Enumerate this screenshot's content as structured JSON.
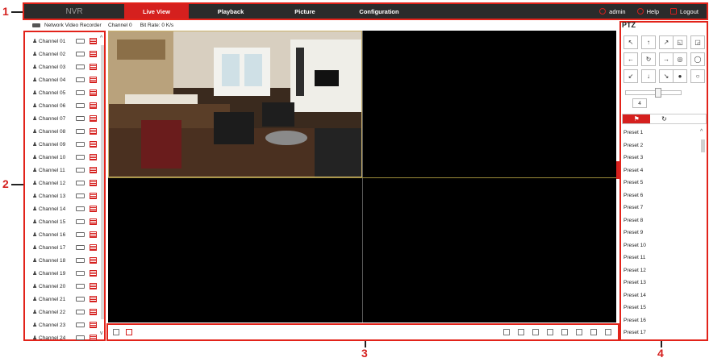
{
  "callouts": {
    "c1": "1",
    "c2": "2",
    "c3": "3",
    "c4": "4"
  },
  "header": {
    "logo": "NVR",
    "nav": [
      "Live View",
      "Playback",
      "Picture",
      "Configuration"
    ],
    "user": "admin",
    "help": "Help",
    "logout": "Logout"
  },
  "sidebar": {
    "device": "Network Video Recorder",
    "channels": [
      "Channel 01",
      "Channel 02",
      "Channel 03",
      "Channel 04",
      "Channel 05",
      "Channel 06",
      "Channel 07",
      "Channel 08",
      "Channel 09",
      "Channel 10",
      "Channel 11",
      "Channel 12",
      "Channel 13",
      "Channel 14",
      "Channel 15",
      "Channel 16",
      "Channel 17",
      "Channel 18",
      "Channel 19",
      "Channel 20",
      "Channel 21",
      "Channel 22",
      "Channel 23",
      "Channel 24"
    ]
  },
  "video": {
    "channel": "Channel 0",
    "bitrate": "Bit Rate: 0 K/s"
  },
  "ptz": {
    "title": "PTZ",
    "speed": "4",
    "presets": [
      "Preset 1",
      "Preset 2",
      "Preset 3",
      "Preset 4",
      "Preset 5",
      "Preset 6",
      "Preset 7",
      "Preset 8",
      "Preset 9",
      "Preset 10",
      "Preset 11",
      "Preset 12",
      "Preset 13",
      "Preset 14",
      "Preset 15",
      "Preset 16",
      "Preset 17"
    ]
  },
  "colors": {
    "accent": "#d5201e",
    "topbar": "#2b2b2b"
  }
}
